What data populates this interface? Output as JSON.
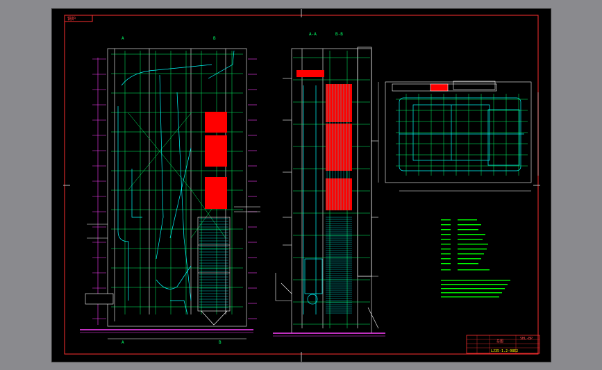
{
  "drawing": {
    "title_tab": "锅炉",
    "section_label_a": "A-A",
    "section_label_b": "B-B",
    "section_mark_a_top": "A",
    "section_mark_a_bottom": "A",
    "section_mark_b_top": "B",
    "section_mark_b_bottom": "B"
  },
  "title_block": {
    "drawing_name": "总图",
    "company": "SHL-BP",
    "drawing_no": "LJ35-1.2-08E2"
  },
  "colors": {
    "frame": "#ff3030",
    "background": "#000000",
    "structure": "#ffffff",
    "pipes": "#00ffff",
    "steel": "#00ff66",
    "dims": "#ff40ff",
    "heating": "#ff0000",
    "notes": "#00ff00"
  }
}
